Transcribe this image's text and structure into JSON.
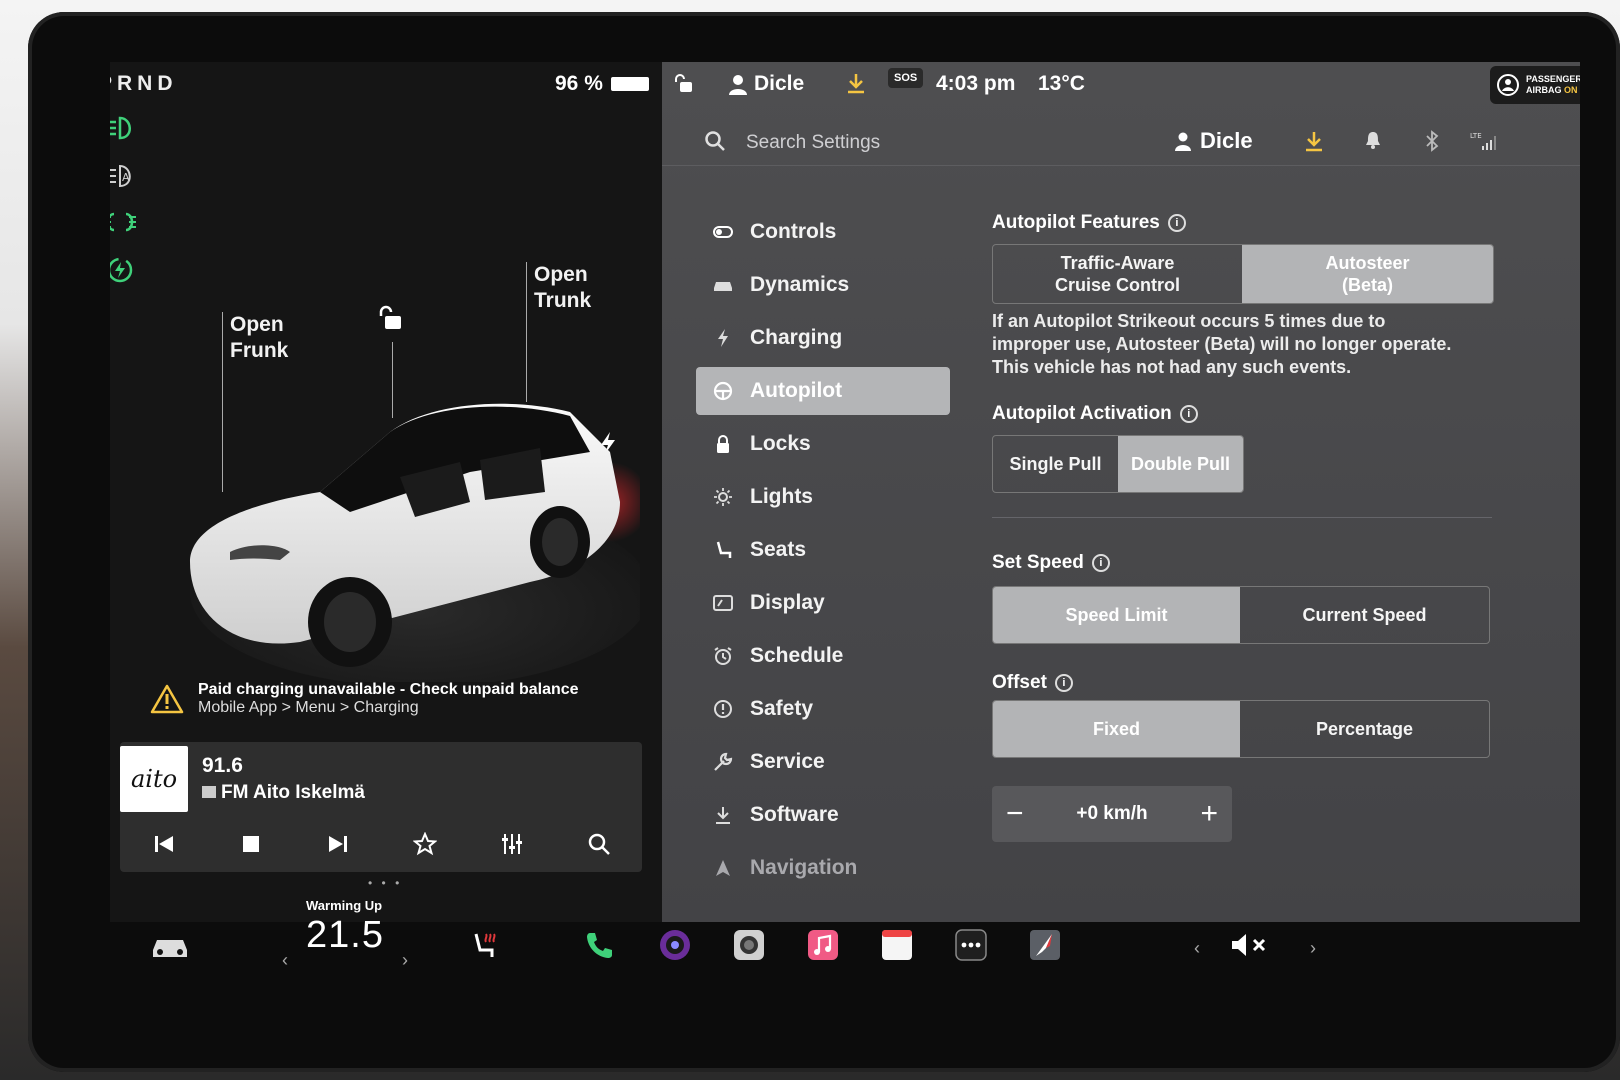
{
  "status": {
    "gear": "PRND",
    "battery_percent": "96 %",
    "driver": "Dicle",
    "time": "4:03 pm",
    "outside_temp": "13°C",
    "sos": "SOS",
    "airbag_line1": "PASSENGER",
    "airbag_line2": "AIRBAG",
    "airbag_state": "ON"
  },
  "car_panel": {
    "frunk_label_1": "Open",
    "frunk_label_2": "Frunk",
    "trunk_label_1": "Open",
    "trunk_label_2": "Trunk",
    "alert_title": "Paid charging unavailable - Check unpaid balance",
    "alert_sub": "Mobile App > Menu > Charging"
  },
  "media": {
    "logo": "aito",
    "frequency": "91.6",
    "station": "FM Aito Iskelmä"
  },
  "settings": {
    "search_placeholder": "Search Settings",
    "profile_name": "Dicle",
    "menu": [
      {
        "label": "Controls"
      },
      {
        "label": "Dynamics"
      },
      {
        "label": "Charging"
      },
      {
        "label": "Autopilot"
      },
      {
        "label": "Locks"
      },
      {
        "label": "Lights"
      },
      {
        "label": "Seats"
      },
      {
        "label": "Display"
      },
      {
        "label": "Schedule"
      },
      {
        "label": "Safety"
      },
      {
        "label": "Service"
      },
      {
        "label": "Software"
      },
      {
        "label": "Navigation"
      }
    ],
    "active_menu": "Autopilot",
    "autopilot_features": {
      "title": "Autopilot Features",
      "opt1_line1": "Traffic-Aware",
      "opt1_line2": "Cruise Control",
      "opt2_line1": "Autosteer",
      "opt2_line2": "(Beta)",
      "selected": "Autosteer (Beta)",
      "desc1": "If an Autopilot Strikeout occurs 5 times due to",
      "desc2": "improper use, Autosteer (Beta) will no longer operate.",
      "desc3": "This vehicle has not had any such events."
    },
    "autopilot_activation": {
      "title": "Autopilot Activation",
      "options": [
        "Single Pull",
        "Double Pull"
      ],
      "selected": "Double Pull"
    },
    "set_speed": {
      "title": "Set Speed",
      "options": [
        "Speed Limit",
        "Current Speed"
      ],
      "selected": "Speed Limit"
    },
    "offset": {
      "title": "Offset",
      "options": [
        "Fixed",
        "Percentage"
      ],
      "selected": "Fixed",
      "value": "+0 km/h",
      "minus": "−",
      "plus": "+"
    }
  },
  "dock": {
    "climate_label": "Warming Up",
    "climate_temp": "21.5",
    "pager": "• • •"
  },
  "colors": {
    "accent_green": "#3fd17a",
    "accent_yellow": "#f5c542",
    "selected_segment": "#b3b4b6",
    "settings_bg": "#4a4a4c"
  }
}
